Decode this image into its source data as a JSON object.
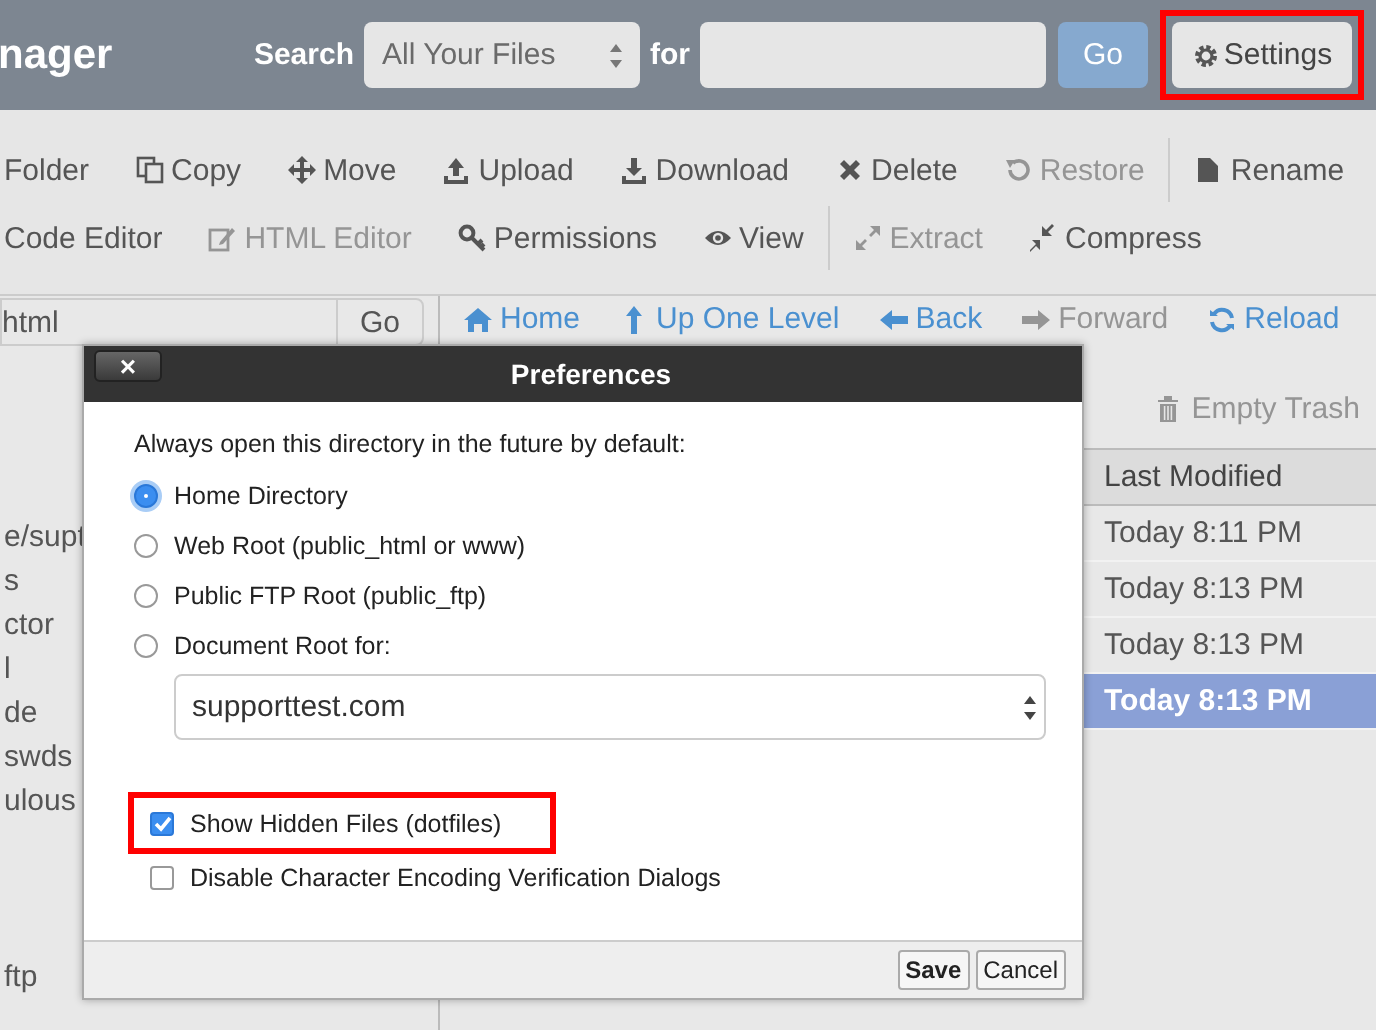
{
  "header": {
    "title": "nager",
    "search_label": "Search",
    "scope_select": {
      "value": "All Your Files"
    },
    "for_label": "for",
    "go_button": "Go",
    "settings_button": {
      "label": "Settings",
      "highlighted": true
    }
  },
  "toolbar": {
    "rows": [
      {
        "groups": [
          [
            {
              "label": "Folder",
              "disabled": false
            },
            {
              "label": "Copy",
              "disabled": false
            },
            {
              "label": "Move",
              "disabled": false
            },
            {
              "label": "Upload",
              "disabled": false
            },
            {
              "label": "Download",
              "disabled": false
            },
            {
              "label": "Delete",
              "disabled": false
            },
            {
              "label": "Restore",
              "disabled": true
            }
          ],
          [
            {
              "label": "Rename",
              "disabled": false
            }
          ]
        ]
      },
      {
        "groups": [
          [
            {
              "label": "Code Editor",
              "disabled": false
            },
            {
              "label": "HTML Editor",
              "disabled": true
            },
            {
              "label": "Permissions",
              "disabled": false
            },
            {
              "label": "View",
              "disabled": false
            }
          ],
          [
            {
              "label": "Extract",
              "disabled": true
            },
            {
              "label": "Compress",
              "disabled": false
            }
          ]
        ]
      }
    ]
  },
  "left_panel": {
    "path_field": {
      "value": "html"
    },
    "go_button": "Go",
    "tree": [
      {
        "label": "e/supt"
      },
      {
        "label": "s"
      },
      {
        "label": "ctor"
      },
      {
        "label": "l"
      },
      {
        "label": "de"
      },
      {
        "label": "swds"
      },
      {
        "label": "ulous"
      },
      {
        "label": "ftp"
      }
    ]
  },
  "nav": [
    {
      "label": "Home",
      "disabled": false
    },
    {
      "label": "Up One Level",
      "disabled": false
    },
    {
      "label": "Back",
      "disabled": false
    },
    {
      "label": "Forward",
      "disabled": true
    },
    {
      "label": "Reload",
      "disabled": false
    }
  ],
  "empty_trash": {
    "label": "Empty Trash",
    "disabled": true
  },
  "table": {
    "columns": [
      "Last Modified"
    ],
    "rows": [
      {
        "cells": [
          "Today 8:11 PM"
        ],
        "selected": false
      },
      {
        "cells": [
          "Today 8:13 PM"
        ],
        "selected": false
      },
      {
        "cells": [
          "Today 8:13 PM"
        ],
        "selected": false
      },
      {
        "cells": [
          "Today 8:13 PM"
        ],
        "selected": true
      }
    ]
  },
  "dialog": {
    "title": "Preferences",
    "close": "×",
    "prompt": "Always open this directory in the future by default:",
    "options": [
      {
        "label": "Home Directory",
        "selected": true
      },
      {
        "label": "Web Root (public_html or www)",
        "selected": false
      },
      {
        "label": "Public FTP Root (public_ftp)",
        "selected": false
      },
      {
        "label": "Document Root for:",
        "selected": false
      }
    ],
    "domain_select": {
      "value": "supporttest.com"
    },
    "checkboxes": [
      {
        "label": "Show Hidden Files (dotfiles)",
        "checked": true,
        "highlighted": true
      },
      {
        "label": "Disable Character Encoding Verification Dialogs",
        "checked": false,
        "highlighted": false
      }
    ],
    "buttons": [
      {
        "label": "Save",
        "kind": "primary"
      },
      {
        "label": "Cancel",
        "kind": "normal"
      }
    ]
  }
}
